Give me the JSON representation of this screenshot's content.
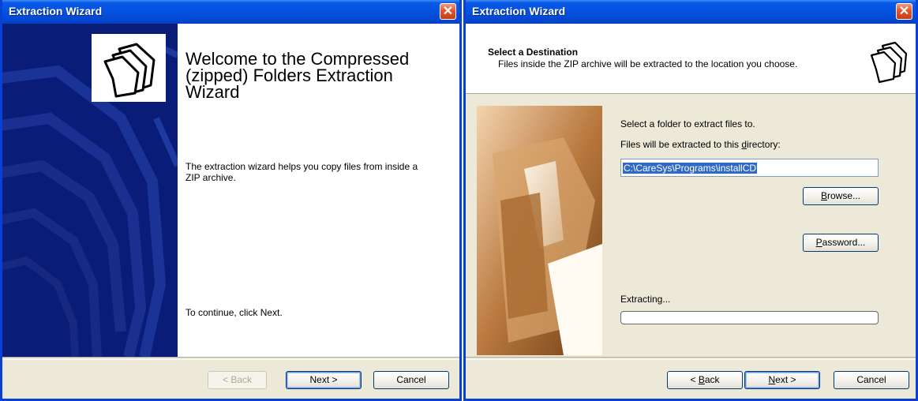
{
  "window1": {
    "title": "Extraction Wizard",
    "close_glyph": "✕",
    "heading": "Welcome to the Compressed (zipped) Folders Extraction Wizard",
    "description": "The extraction wizard helps you copy files from inside a ZIP archive.",
    "continue_text": "To continue, click Next.",
    "buttons": {
      "back": "< Back",
      "next": "Next >",
      "cancel": "Cancel"
    },
    "icon": "zip-folders-icon"
  },
  "window2": {
    "title": "Extraction Wizard",
    "close_glyph": "✕",
    "header_title": "Select a Destination",
    "header_subtitle": "Files inside the ZIP archive will be extracted to the location you choose.",
    "instruction": "Select a folder to extract files to.",
    "dir_label": "Files will be extracted to this directory:",
    "path_value": "C:\\CareSys\\Programs\\installCD",
    "browse_label": "Browse...",
    "password_label": "Password...",
    "extracting_label": "Extracting...",
    "progress": 0,
    "buttons": {
      "back": "< Back",
      "next": "Next >",
      "cancel": "Cancel"
    },
    "icon": "zip-folders-icon"
  },
  "colors": {
    "titlebar": "#0553e1",
    "side_panel": "#091c78",
    "dialog_bg": "#ece9d8",
    "selection": "#316ac5"
  }
}
